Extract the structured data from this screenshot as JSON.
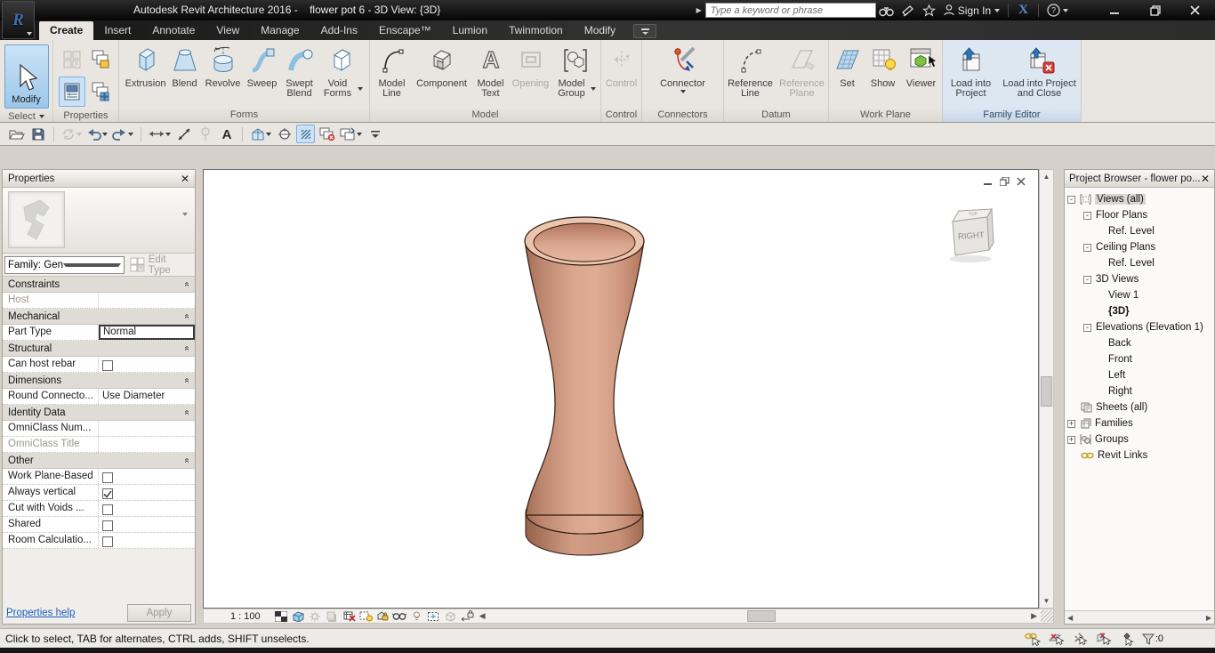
{
  "title_bar": {
    "title": "Autodesk Revit Architecture 2016 -    flower pot 6 - 3D View: {3D}",
    "search_placeholder": "Type a keyword or phrase",
    "sign_in_label": "Sign In"
  },
  "tabs": {
    "items": [
      {
        "label": "Create",
        "active": true
      },
      {
        "label": "Insert",
        "active": false
      },
      {
        "label": "Annotate",
        "active": false
      },
      {
        "label": "View",
        "active": false
      },
      {
        "label": "Manage",
        "active": false
      },
      {
        "label": "Add-Ins",
        "active": false
      },
      {
        "label": "Enscape™",
        "active": false
      },
      {
        "label": "Lumion",
        "active": false
      },
      {
        "label": "Twinmotion",
        "active": false
      },
      {
        "label": "Modify",
        "active": false
      }
    ]
  },
  "ribbon": {
    "select_group": {
      "label": "Select",
      "modify_label": "Modify"
    },
    "properties_group": {
      "label": "Properties"
    },
    "forms_group": {
      "label": "Forms",
      "extrusion": "Extrusion",
      "blend": "Blend",
      "revolve": "Revolve",
      "sweep": "Sweep",
      "swept_blend": "Swept Blend",
      "void_forms": "Void Forms"
    },
    "model_group": {
      "label": "Model",
      "model_line": "Model Line",
      "component": "Component",
      "model_text": "Model Text",
      "opening": "Opening",
      "model_group_btn": "Model Group"
    },
    "control_group": {
      "label": "Control",
      "control": "Control"
    },
    "connectors_group": {
      "label": "Connectors",
      "connector": "Connector"
    },
    "datum_group": {
      "label": "Datum",
      "reference_line": "Reference Line",
      "reference_plane": "Reference Plane"
    },
    "work_plane_group": {
      "label": "Work Plane",
      "set": "Set",
      "show": "Show",
      "viewer": "Viewer"
    },
    "family_editor_group": {
      "label": "Family Editor",
      "load_into_project": "Load into Project",
      "load_into_project_and_close": "Load into Project and Close"
    }
  },
  "properties_panel": {
    "title": "Properties",
    "family_selector": "Family: Generic Mode",
    "edit_type_label": "Edit Type",
    "constraints": {
      "header": "Constraints",
      "host_label": "Host",
      "host_value": ""
    },
    "mechanical": {
      "header": "Mechanical",
      "part_type_label": "Part Type",
      "part_type_value": "Normal"
    },
    "structural": {
      "header": "Structural",
      "can_host_rebar_label": "Can host rebar",
      "can_host_rebar_checked": false
    },
    "dimensions": {
      "header": "Dimensions",
      "round_connector_label": "Round Connecto...",
      "round_connector_value": "Use Diameter"
    },
    "identity_data": {
      "header": "Identity Data",
      "omniclass_number_label": "OmniClass Num...",
      "omniclass_number_value": "",
      "omniclass_title_label": "OmniClass Title",
      "omniclass_title_value": ""
    },
    "other": {
      "header": "Other",
      "rows": [
        {
          "label": "Work Plane-Based",
          "checked": false
        },
        {
          "label": "Always vertical",
          "checked": true
        },
        {
          "label": "Cut with Voids ...",
          "checked": false
        },
        {
          "label": "Shared",
          "checked": false
        },
        {
          "label": "Room Calculatio...",
          "checked": false
        }
      ]
    },
    "help_link": "Properties help",
    "apply_label": "Apply"
  },
  "project_browser": {
    "title": "Project Browser - flower po...",
    "items": [
      {
        "label": "Views (all)",
        "selected": true
      },
      {
        "label": "Floor Plans"
      },
      {
        "label": "Ref. Level"
      },
      {
        "label": "Ceiling Plans"
      },
      {
        "label": "Ref. Level"
      },
      {
        "label": "3D Views"
      },
      {
        "label": "View 1"
      },
      {
        "label": "{3D}",
        "bold": true
      },
      {
        "label": "Elevations (Elevation 1)"
      },
      {
        "label": "Back"
      },
      {
        "label": "Front"
      },
      {
        "label": "Left"
      },
      {
        "label": "Right"
      },
      {
        "label": "Sheets (all)"
      },
      {
        "label": "Families"
      },
      {
        "label": "Groups"
      },
      {
        "label": "Revit Links"
      }
    ]
  },
  "canvas": {
    "scale": "1 : 100",
    "viewcube_face": "RIGHT",
    "vase_colors": {
      "light": "#E2B098",
      "mid": "#D49A82",
      "dark": "#9E6B54",
      "rim": "#ECC5AF"
    }
  },
  "status_bar": {
    "message": "Click to select, TAB for alternates, CTRL adds, SHIFT unselects.",
    "filter_count": ":0"
  },
  "colors": {
    "selection_highlight": "#CBE2F6",
    "family_editor_tint": "#DCE7F2",
    "ribbon_background": "#E9E6E2"
  }
}
